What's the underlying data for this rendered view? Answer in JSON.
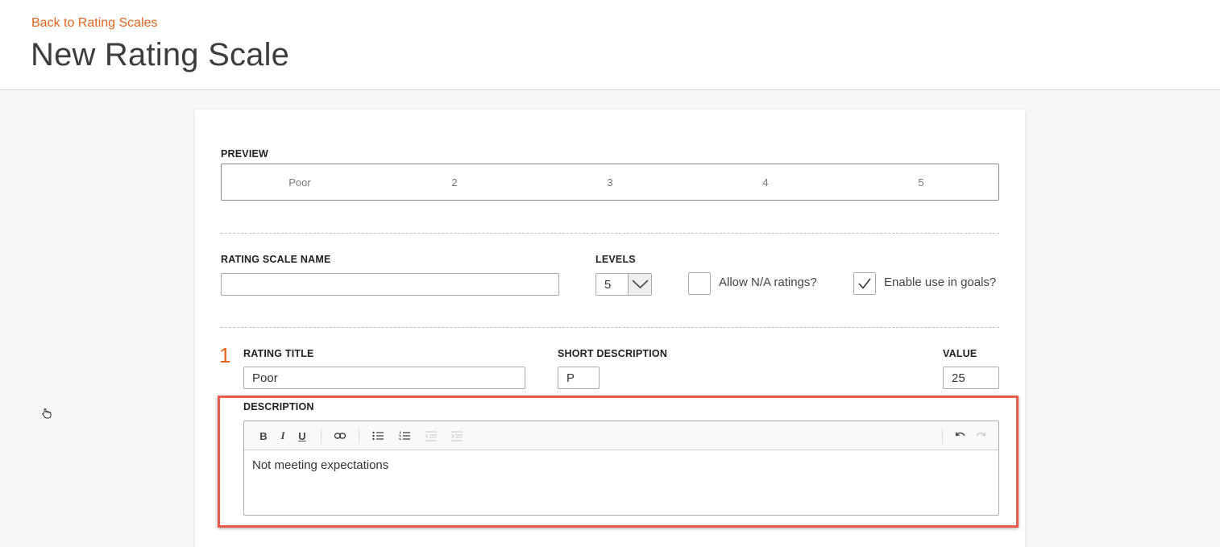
{
  "header": {
    "back_link": "Back to Rating Scales",
    "title": "New Rating Scale"
  },
  "preview": {
    "label": "PREVIEW",
    "items": [
      "Poor",
      "2",
      "3",
      "4",
      "5"
    ]
  },
  "settings": {
    "name_label": "RATING SCALE NAME",
    "name_value": "",
    "levels_label": "LEVELS",
    "levels_value": "5",
    "allow_na_label": "Allow N/A ratings?",
    "allow_na_checked": false,
    "goals_label": "Enable use in goals?",
    "goals_checked": true
  },
  "rating": {
    "number": "1",
    "title_label": "RATING TITLE",
    "title_value": "Poor",
    "short_label": "SHORT DESCRIPTION",
    "short_value": "P",
    "value_label": "VALUE",
    "value_value": "25",
    "description_label": "DESCRIPTION",
    "description_text": "Not meeting expectations"
  },
  "colors": {
    "accent": "#e3651d",
    "highlight": "#ea5a4b"
  },
  "toolbar_icons": [
    "bold-icon",
    "italic-icon",
    "underline-icon",
    "link-icon",
    "bulleted-list-icon",
    "numbered-list-icon",
    "outdent-icon",
    "indent-icon",
    "undo-icon",
    "redo-icon"
  ]
}
